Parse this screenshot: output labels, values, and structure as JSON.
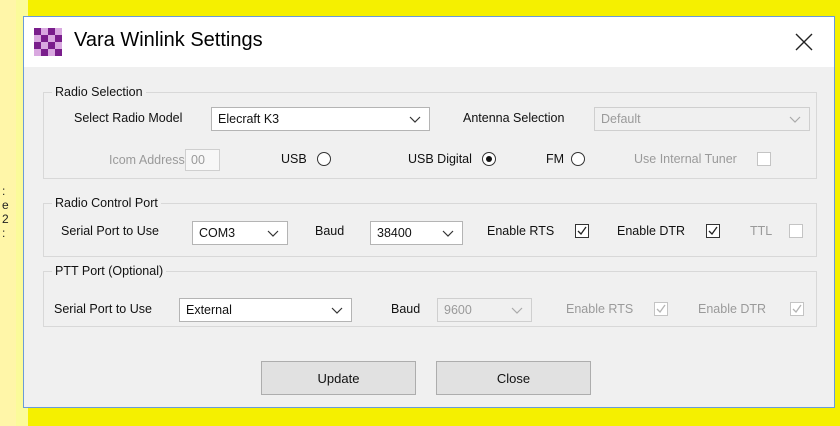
{
  "window": {
    "title": "Vara Winlink Settings",
    "close_glyph": "✕",
    "icon": "checkered-app-icon"
  },
  "background_edge_text": [
    ":",
    "e",
    "2",
    ":"
  ],
  "radio_selection": {
    "legend": "Radio Selection",
    "select_radio_model_label": "Select Radio Model",
    "radio_model_value": "Elecraft K3",
    "antenna_selection_label": "Antenna Selection",
    "antenna_selection_value": "Default",
    "icom_address_label": "Icom Address",
    "icom_address_value": "00",
    "usb_label": "USB",
    "usb_digital_label": "USB Digital",
    "fm_label": "FM",
    "use_internal_tuner_label": "Use Internal Tuner",
    "mode_selected": "USB Digital",
    "use_internal_tuner_checked": false
  },
  "radio_control_port": {
    "legend": "Radio Control Port",
    "serial_port_label": "Serial Port to Use",
    "serial_port_value": "COM3",
    "baud_label": "Baud",
    "baud_value": "38400",
    "enable_rts_label": "Enable RTS",
    "enable_rts_checked": true,
    "enable_dtr_label": "Enable DTR",
    "enable_dtr_checked": true,
    "ttl_label": "TTL",
    "ttl_checked": false
  },
  "ptt_port": {
    "legend": "PTT Port (Optional)",
    "serial_port_label": "Serial Port to Use",
    "serial_port_value": "External",
    "baud_label": "Baud",
    "baud_value": "9600",
    "enable_rts_label": "Enable RTS",
    "enable_rts_checked": true,
    "enable_dtr_label": "Enable DTR",
    "enable_dtr_checked": true
  },
  "buttons": {
    "update_label": "Update",
    "close_label": "Close"
  },
  "colors": {
    "desktop_background": "#f5f000",
    "window_border": "#6a9bd8",
    "icon_purple": "#7a1e8c"
  }
}
